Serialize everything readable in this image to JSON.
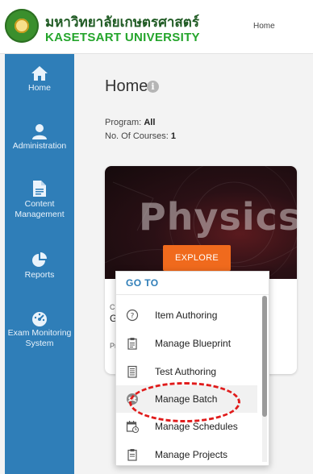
{
  "header": {
    "university_thai": "มหาวิทยาลัยเกษตรศาสตร์",
    "university_en": "KASETSART UNIVERSITY",
    "nav_home": "Home"
  },
  "sidebar": {
    "items": [
      {
        "label": "Home",
        "icon": "house-icon"
      },
      {
        "label": "Administration",
        "icon": "user-icon"
      },
      {
        "label": "Content Management",
        "icon": "file-icon"
      },
      {
        "label": "Reports",
        "icon": "pie-chart-icon"
      },
      {
        "label": "Exam Monitoring System",
        "icon": "dashboard-icon"
      }
    ]
  },
  "main": {
    "title": "Home",
    "program_label": "Program:",
    "program_value": "All",
    "courses_label": "No. Of Courses:",
    "courses_value": "1"
  },
  "course_card": {
    "banner_word": "Physics",
    "explore_label": "EXPLORE",
    "peek_initial": "G",
    "peek_small_1": "C",
    "peek_small_2": "Pr"
  },
  "goto_menu": {
    "title": "GO TO",
    "items": [
      {
        "label": "Item Authoring",
        "icon": "question-circle-icon"
      },
      {
        "label": "Manage Blueprint",
        "icon": "clipboard-icon"
      },
      {
        "label": "Test Authoring",
        "icon": "document-list-icon"
      },
      {
        "label": "Manage Batch",
        "icon": "group-icon"
      },
      {
        "label": "Manage Schedules",
        "icon": "calendar-icon"
      },
      {
        "label": "Manage Projects",
        "icon": "clipboard-list-icon"
      }
    ],
    "highlighted_item": "Manage Batch"
  },
  "colors": {
    "sidebar": "#2f7eb8",
    "accent_orange": "#f06a1d",
    "highlight_ring": "#e01b1b",
    "menu_title": "#2f7eb8"
  }
}
